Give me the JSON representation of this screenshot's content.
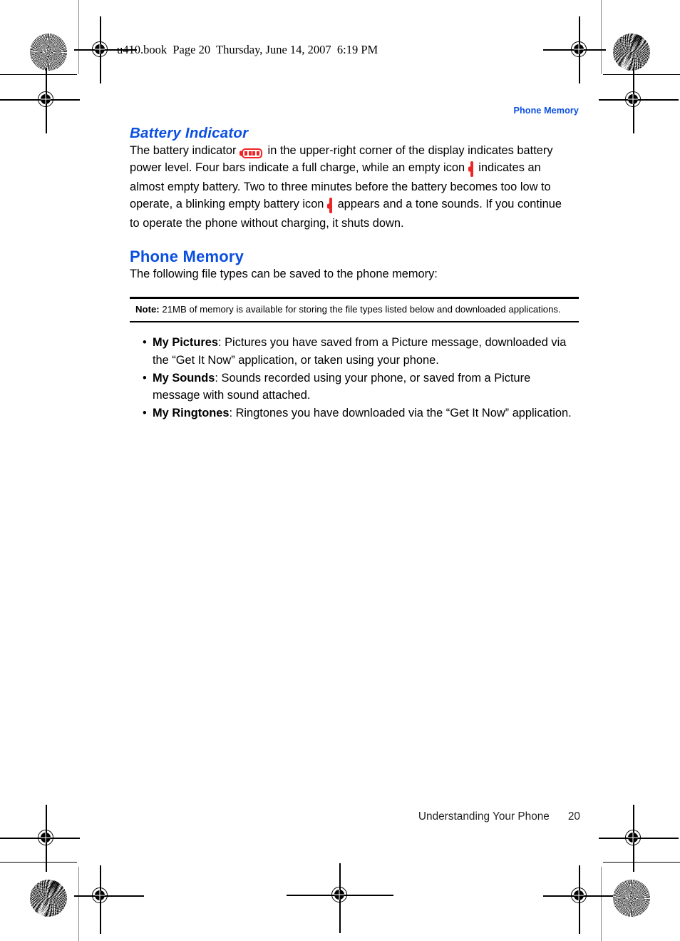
{
  "page": {
    "filestamp": "u410.book  Page 20  Thursday, June 14, 2007  6:19 PM",
    "running_header": "Phone Memory",
    "heading_color": "#0b4fe0",
    "battery_icon_color": "#ef2424"
  },
  "sections": {
    "battery_indicator": {
      "heading": "Battery Indicator",
      "paragraph": {
        "part1": "The battery indicator",
        "part2": "in the upper-right corner of the display indicates battery power level. Four bars indicate a full charge, while an empty icon",
        "part3": "indicates an almost empty battery. Two to three minutes before the battery becomes too low to operate, a blinking empty battery icon",
        "part4": "appears and a tone sounds. If you continue to operate the phone without charging, it shuts down."
      },
      "icons": {
        "full_battery": "battery-full-icon",
        "empty_battery": "battery-empty-icon",
        "blinking_empty_battery": "battery-empty-blinking-icon",
        "full_battery_bars": 4
      }
    },
    "phone_memory": {
      "heading": "Phone Memory",
      "intro": "The following file types can be saved to the phone memory:",
      "note": {
        "label": "Note:",
        "text": "21MB of memory is available for storing the file types listed below and downloaded applications."
      },
      "file_types": [
        {
          "bullet": "•",
          "term": "My Pictures",
          "separator": ": ",
          "description": "Pictures you have saved from a Picture message, downloaded via the “Get It Now” application, or taken using your phone."
        },
        {
          "bullet": "•",
          "term": "My Sounds",
          "separator": ": ",
          "description": "Sounds recorded using your phone, or saved from a Picture message with sound attached."
        },
        {
          "bullet": "•",
          "term": "My Ringtones",
          "separator": ": ",
          "description": "Ringtones you have downloaded via the “Get It Now” application."
        }
      ]
    }
  },
  "footer": {
    "chapter": "Understanding Your Phone",
    "page_number": "20"
  }
}
